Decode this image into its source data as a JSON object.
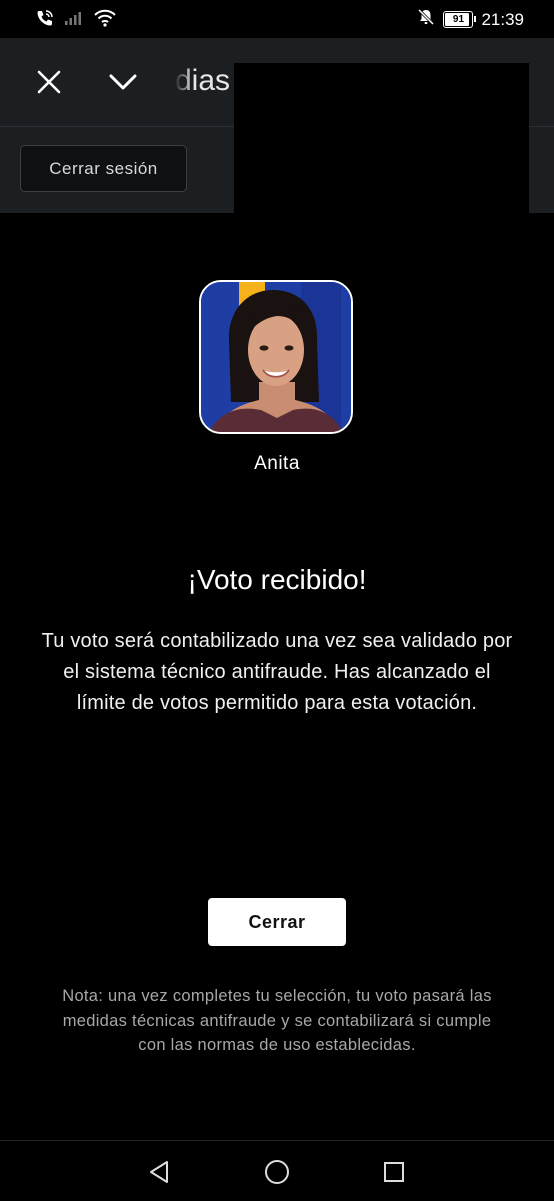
{
  "status_bar": {
    "time": "21:39",
    "battery": "91",
    "icons": [
      "wifi-calling-icon",
      "signal-icon",
      "wifi-icon",
      "mute-icon",
      "battery-icon"
    ]
  },
  "header": {
    "title_fragment": "dias",
    "close_icon": "close-icon",
    "collapse_icon": "chevron-down-icon",
    "logout_label": "Cerrar sesión"
  },
  "candidate": {
    "name": "Anita"
  },
  "confirmation": {
    "heading": "¡Voto recibido!",
    "message": "Tu voto será contabilizado una vez sea validado por el sistema técnico antifraude. Has alcanzado el límite de votos permitido para esta votación.",
    "close_label": "Cerrar",
    "note": "Nota: una vez completes tu selección, tu voto pasará las medidas técnicas antifraude y se contabilizará si cumple con las normas de uso establecidas."
  },
  "nav_bar": {
    "icons": [
      "back-icon",
      "home-icon",
      "recents-icon"
    ]
  },
  "colors": {
    "background": "#000000",
    "header": "#1c1f22",
    "avatar_bg": "#1e3ea6",
    "avatar_stripe": "#f5b21a"
  }
}
